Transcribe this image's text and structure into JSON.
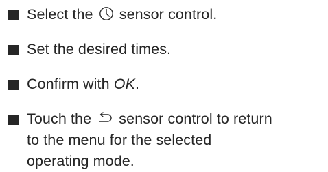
{
  "steps": [
    {
      "before": "Select the",
      "icon": "clock-icon",
      "after": "sensor control."
    },
    {
      "text": "Set the desired times."
    },
    {
      "before": "Confirm with ",
      "emphasis": "OK",
      "after": "."
    },
    {
      "before": "Touch the",
      "icon": "return-arrow-icon",
      "after_line1": "sensor control to return",
      "line2": "to the menu for the selected",
      "line3": "operating mode."
    }
  ],
  "colors": {
    "text": "#262626",
    "bullet": "#262626",
    "background": "#ffffff"
  }
}
